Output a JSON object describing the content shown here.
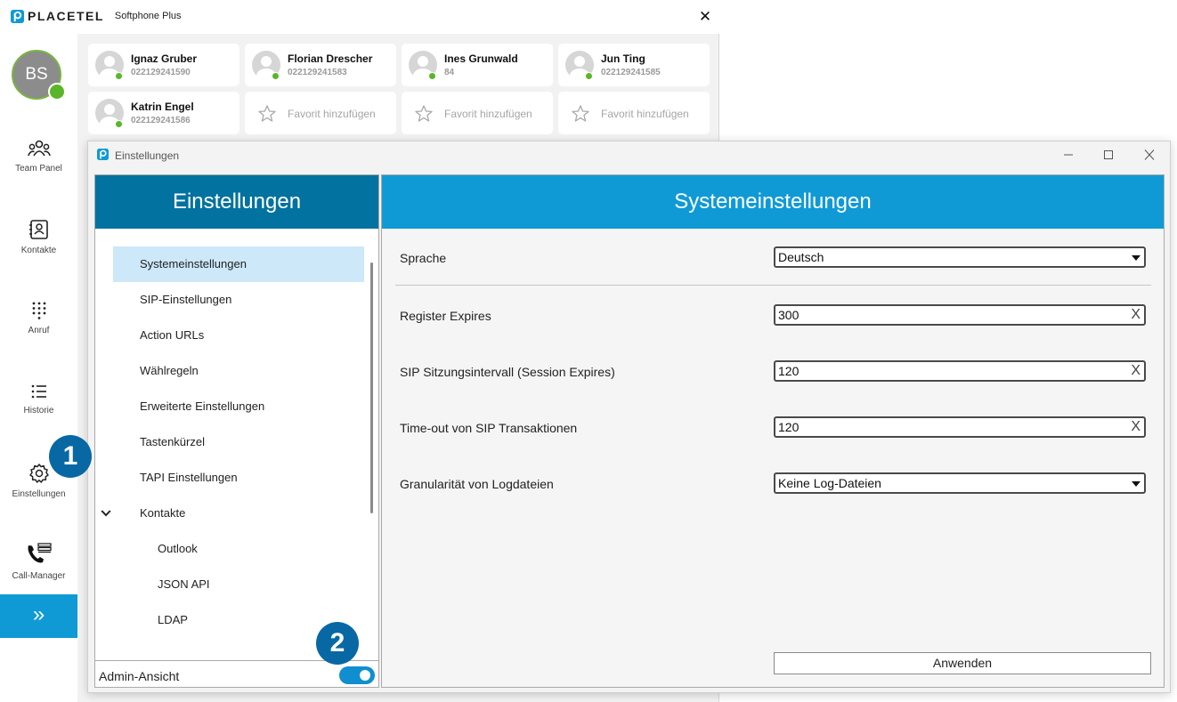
{
  "app": {
    "brand": "PLACETEL",
    "product": "Softphone Plus",
    "close_glyph": "✕",
    "colors": {
      "accent": "#0f9ad6",
      "header_dark": "#0272a0",
      "status_green": "#5bb52a",
      "badge": "#0868a4"
    }
  },
  "user": {
    "initials": "BS"
  },
  "sidebar": {
    "items": [
      {
        "label": "Team Panel",
        "icon": "team-icon"
      },
      {
        "label": "Kontakte",
        "icon": "contacts-icon"
      },
      {
        "label": "Anruf",
        "icon": "dialpad-icon"
      },
      {
        "label": "Historie",
        "icon": "history-icon"
      },
      {
        "label": "Einstellungen",
        "icon": "gear-icon"
      },
      {
        "label": "Call-Manager",
        "icon": "call-manager-icon"
      }
    ],
    "expand_glyph": "»"
  },
  "favorites": [
    {
      "name": "Ignaz Gruber",
      "number": "022129241590"
    },
    {
      "name": "Florian Drescher",
      "number": "022129241583"
    },
    {
      "name": "Ines Grunwald",
      "number": "84"
    },
    {
      "name": "Jun Ting",
      "number": "022129241585"
    },
    {
      "name": "Katrin Engel",
      "number": "022129241586"
    }
  ],
  "favorite_placeholders": [
    "Favorit hinzufügen",
    "Favorit hinzufügen",
    "Favorit hinzufügen"
  ],
  "dialog": {
    "title": "Einstellungen",
    "left_header": "Einstellungen",
    "right_header": "Systemeinstellungen",
    "tree": [
      {
        "label": "Systemeinstellungen",
        "selected": true
      },
      {
        "label": "SIP-Einstellungen"
      },
      {
        "label": "Action URLs"
      },
      {
        "label": "Wählregeln"
      },
      {
        "label": "Erweiterte Einstellungen"
      },
      {
        "label": "Tastenkürzel"
      },
      {
        "label": "TAPI Einstellungen"
      },
      {
        "label": "Kontakte",
        "expanded": true
      },
      {
        "label": "Outlook"
      },
      {
        "label": "JSON API"
      },
      {
        "label": "LDAP"
      }
    ],
    "admin_view_label": "Admin-Ansicht",
    "admin_view_on": true,
    "settings": {
      "language": {
        "label": "Sprache",
        "value": "Deutsch"
      },
      "register_expires": {
        "label": "Register Expires",
        "value": "300"
      },
      "session_expires": {
        "label": "SIP Sitzungsintervall (Session Expires)",
        "value": "120"
      },
      "sip_timeout": {
        "label": "Time-out von SIP Transaktionen",
        "value": "120"
      },
      "log_granularity": {
        "label": "Granularität von Logdateien",
        "value": "Keine Log-Dateien"
      }
    },
    "apply_label": "Anwenden",
    "clear_glyph": "X"
  },
  "badges": [
    "1",
    "2"
  ]
}
